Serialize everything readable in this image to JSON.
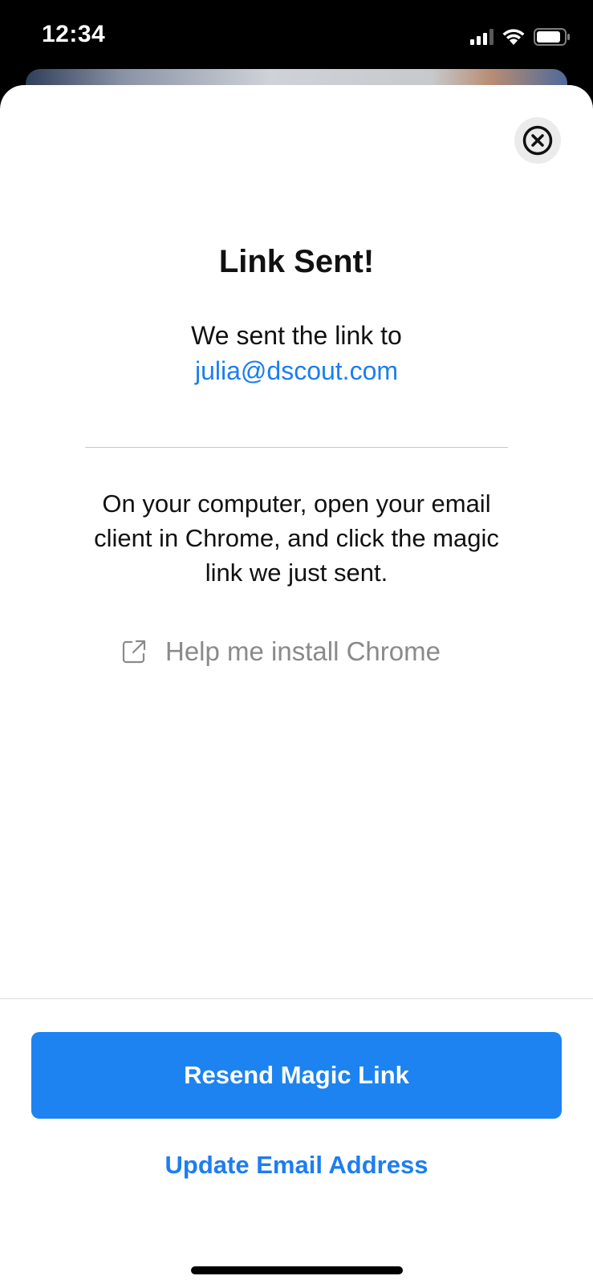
{
  "status_bar": {
    "time": "12:34",
    "icons": [
      "cellular-signal-icon",
      "wifi-icon",
      "battery-icon"
    ]
  },
  "sheet": {
    "close_icon": "close-icon",
    "title": "Link Sent!",
    "sent_to_text": "We sent the link to",
    "email": "julia@dscout.com",
    "instructions": "On your computer, open your email client in Chrome, and click the magic link we just sent.",
    "help_link": {
      "icon": "external-link-icon",
      "label": "Help me install Chrome"
    }
  },
  "footer": {
    "resend_label": "Resend Magic Link",
    "update_email_label": "Update Email Address"
  },
  "colors": {
    "accent": "#1d83f1",
    "link": "#1c7ef0",
    "muted_text": "#8a8a8a"
  }
}
